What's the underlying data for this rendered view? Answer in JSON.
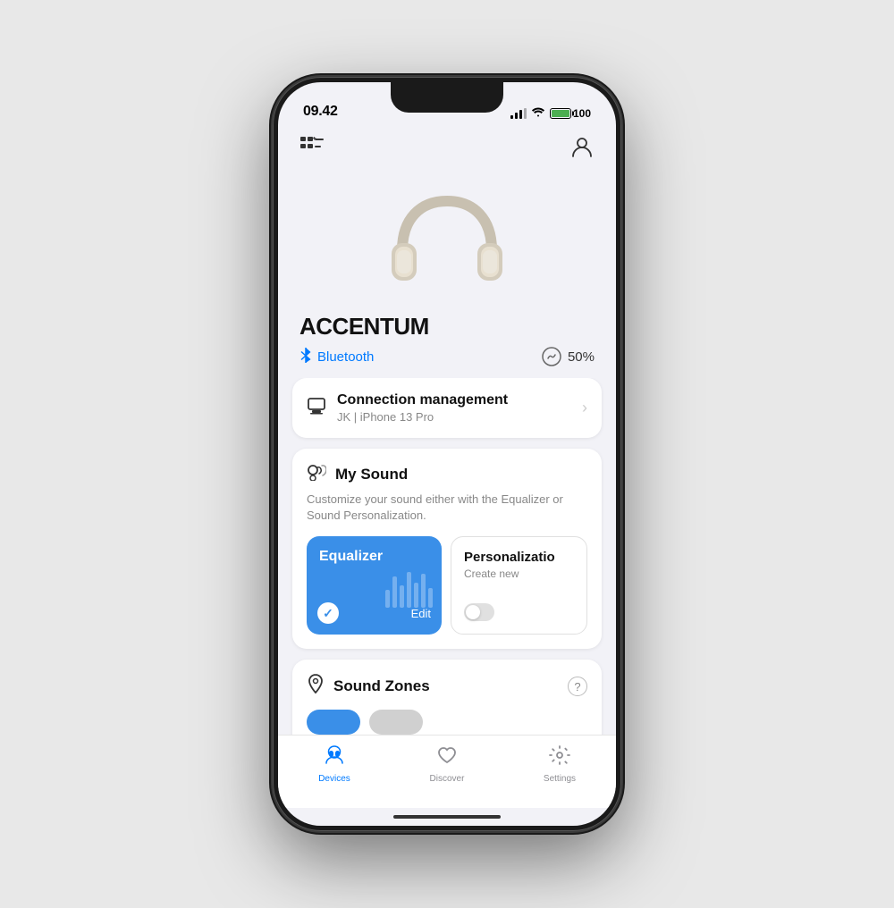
{
  "status_bar": {
    "time": "09.42",
    "battery_percent": "100"
  },
  "header": {
    "menu_label": "menu",
    "profile_label": "profile"
  },
  "device": {
    "name": "ACCENTUM",
    "connection_type": "Bluetooth",
    "battery_level": "50%"
  },
  "connection_management": {
    "title": "Connection management",
    "subtitle": "JK | iPhone 13 Pro",
    "icon": "🖥"
  },
  "my_sound": {
    "title": "My Sound",
    "description": "Customize your sound either with the Equalizer or Sound Personalization.",
    "equalizer": {
      "label": "Equalizer",
      "edit_label": "Edit",
      "selected": true
    },
    "personalization": {
      "label": "Personalizatio",
      "sub_label": "Create new",
      "selected": false
    }
  },
  "sound_zones": {
    "title": "Sound Zones"
  },
  "bottom_nav": {
    "items": [
      {
        "label": "Devices",
        "icon": "headphones",
        "active": true
      },
      {
        "label": "Discover",
        "icon": "heart",
        "active": false
      },
      {
        "label": "Settings",
        "icon": "gear",
        "active": false
      }
    ]
  },
  "colors": {
    "accent_blue": "#3a8fe8",
    "active_nav": "#007aff"
  }
}
